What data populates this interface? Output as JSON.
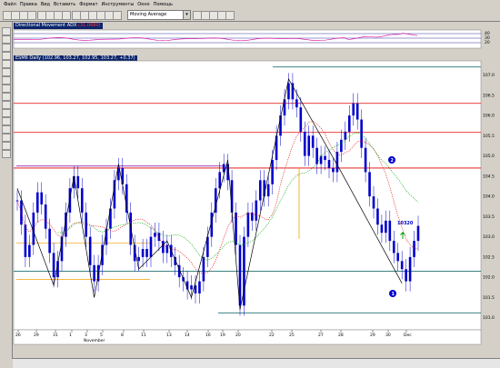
{
  "menu": [
    "Файл",
    "Правка",
    "Вид",
    "Вставить",
    "Формат",
    "Инструменты",
    "Окно",
    "Помощь"
  ],
  "toolbar": {
    "indicator_select": "Moving Average",
    "buttons": [
      "new-icon",
      "open-icon",
      "save-icon",
      "print-icon",
      "cut-icon",
      "copy-icon",
      "paste-icon",
      "undo-icon",
      "chart-type-icon",
      "cursor-icon",
      "zoom-icon",
      "line-tool-icon",
      "text-tool-icon",
      "color-icon",
      "help-icon",
      "fib-icon",
      "arrow-icon",
      "measure-icon",
      "settings-icon"
    ]
  },
  "indicator_panel": {
    "title": "Directional Movement ADX",
    "value": "(31.0680)",
    "axis_labels": [
      "40",
      "30",
      "20"
    ]
  },
  "price_panel": {
    "title": "ESM6 Daily (102.96, 103.27, 102.95, 103.27, +0.37)"
  },
  "annotations": {
    "label_1": "1",
    "label_2": "2",
    "value_label": "10320"
  },
  "colors": {
    "candles": "#0000cc",
    "background": "#ffffff",
    "line_red": "#e00000",
    "line_purple": "#8000a0",
    "line_teal": "#207070",
    "line_orange": "#f0a000",
    "ma_red": "#e00000",
    "ma_green": "#00a000",
    "title_bar": "#0a246a"
  },
  "chart_data": {
    "type": "candlestick",
    "y_axis_labels": [
      "107.0",
      "106.5",
      "106.0",
      "105.5",
      "105.0",
      "104.5",
      "104.0",
      "103.5",
      "103.0",
      "102.5",
      "102.0",
      "101.5",
      "101.0"
    ],
    "ylim": [
      100.7,
      107.35
    ],
    "x_axis_labels": [
      "26",
      "29",
      "31",
      "1",
      "3",
      "5",
      "8",
      "11",
      "13",
      "14",
      "16",
      "19",
      "20",
      "22",
      "25",
      "27",
      "28",
      "29",
      "30",
      "Dec"
    ],
    "x_axis_month": "November",
    "horizontal_levels": [
      {
        "value": 106.3,
        "color": "#e00000"
      },
      {
        "value": 105.58,
        "color": "#e00000"
      },
      {
        "value": 104.7,
        "color": "#e00000"
      },
      {
        "value": 102.15,
        "color": "#207070"
      },
      {
        "value": 101.12,
        "color": "#207070"
      },
      {
        "value": 107.2,
        "color": "#207070"
      }
    ],
    "series": [
      {
        "name": "close",
        "values": [
          103.9,
          103.3,
          102.5,
          102.8,
          103.6,
          104.1,
          103.8,
          103.2,
          102.6,
          102.0,
          102.4,
          103.0,
          103.6,
          104.2,
          104.5,
          104.2,
          103.6,
          103.0,
          102.3,
          101.9,
          102.3,
          102.8,
          103.2,
          103.7,
          104.4,
          104.7,
          104.3,
          103.6,
          102.8,
          102.4,
          102.5,
          102.7,
          102.5,
          103.0,
          103.1,
          102.9,
          102.6,
          102.8,
          102.5,
          102.3,
          102.0,
          101.9,
          101.7,
          101.8,
          101.6,
          101.9,
          102.5,
          103.0,
          103.6,
          104.2,
          104.6,
          104.8,
          104.4,
          103.6,
          102.8,
          101.3,
          103.0,
          103.6,
          103.4,
          103.9,
          104.4,
          104.0,
          104.3,
          104.9,
          105.5,
          106.0,
          106.4,
          106.8,
          106.4,
          106.2,
          105.6,
          105.0,
          105.5,
          105.2,
          104.8,
          105.0,
          104.9,
          104.7,
          104.6,
          105.1,
          105.4,
          105.6,
          106.0,
          106.3,
          105.9,
          105.2,
          104.6,
          104.0,
          103.7,
          103.3,
          103.1,
          103.4,
          102.9,
          102.6,
          102.4,
          102.2,
          101.9,
          102.5,
          102.9,
          103.27
        ]
      }
    ]
  }
}
